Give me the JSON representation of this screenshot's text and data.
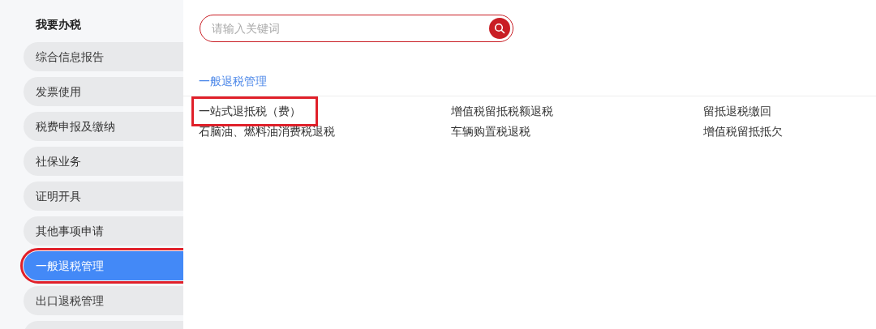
{
  "sidebar": {
    "title": "我要办税",
    "items": [
      {
        "label": "综合信息报告",
        "selected": false,
        "highlighted": false
      },
      {
        "label": "发票使用",
        "selected": false,
        "highlighted": false
      },
      {
        "label": "税费申报及缴纳",
        "selected": false,
        "highlighted": false
      },
      {
        "label": "社保业务",
        "selected": false,
        "highlighted": false
      },
      {
        "label": "证明开具",
        "selected": false,
        "highlighted": false
      },
      {
        "label": "其他事项申请",
        "selected": false,
        "highlighted": false
      },
      {
        "label": "一般退税管理",
        "selected": true,
        "highlighted": true
      },
      {
        "label": "出口退税管理",
        "selected": false,
        "highlighted": false
      }
    ]
  },
  "search": {
    "placeholder": "请输入关键词"
  },
  "section": {
    "title": "一般退税管理",
    "links": [
      {
        "label": "一站式退抵税（费）",
        "highlighted": true
      },
      {
        "label": "增值税留抵税额退税",
        "highlighted": false
      },
      {
        "label": "留抵退税缴回",
        "highlighted": false
      },
      {
        "label": "石脑油、燃料油消费税退税",
        "highlighted": false
      },
      {
        "label": "车辆购置税退税",
        "highlighted": false
      },
      {
        "label": "增值税留抵抵欠",
        "highlighted": false
      }
    ]
  }
}
